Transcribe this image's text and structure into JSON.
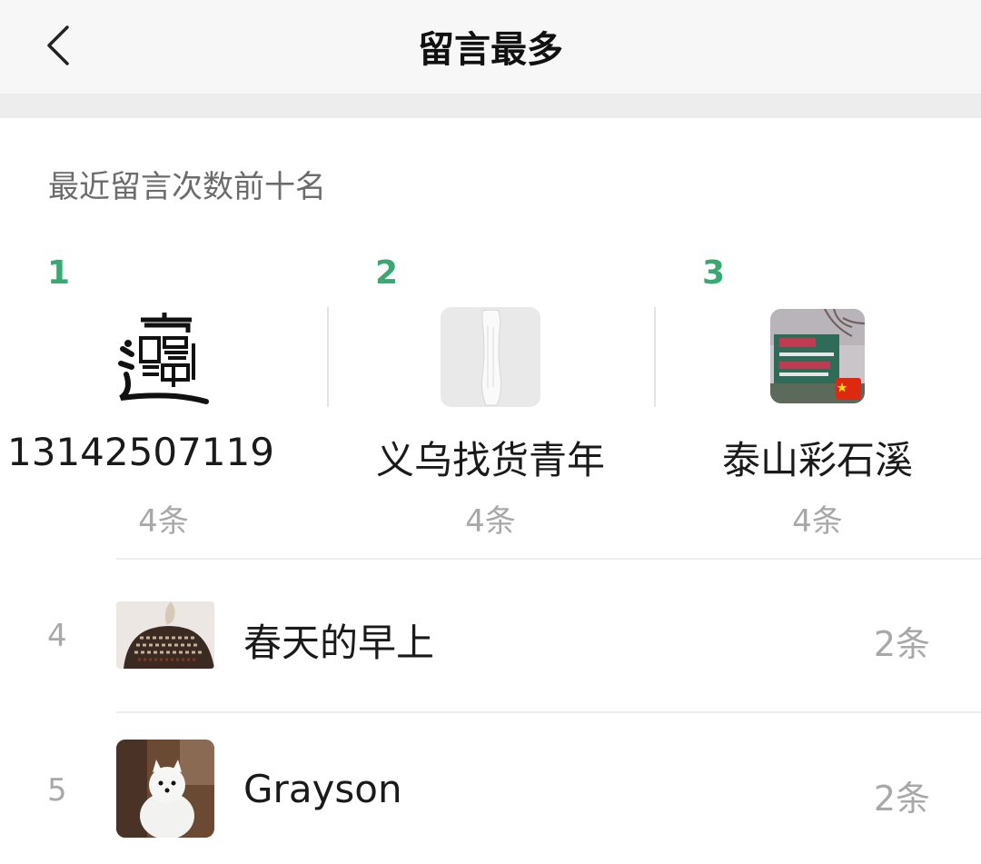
{
  "header": {
    "title": "留言最多",
    "back_icon": "chevron-left-icon"
  },
  "section": {
    "subtitle": "最近留言次数前十名"
  },
  "colors": {
    "rank_accent": "#3aa872",
    "muted_text": "#a8a8a8"
  },
  "top3": [
    {
      "rank": "1",
      "name": "13142507119",
      "count": "4条",
      "avatar_icon": "calligraphy-character-avatar"
    },
    {
      "rank": "2",
      "name": "义乌找货青年",
      "count": "4条",
      "avatar_icon": "white-garment-avatar"
    },
    {
      "rank": "3",
      "name": "泰山彩石溪",
      "count": "4条",
      "avatar_icon": "scenic-sign-avatar"
    }
  ],
  "list": [
    {
      "rank": "4",
      "name": "春天的早上",
      "count": "2条",
      "avatar_icon": "sweater-photo-avatar"
    },
    {
      "rank": "5",
      "name": "Grayson",
      "count": "2条",
      "avatar_icon": "white-dog-avatar"
    }
  ]
}
